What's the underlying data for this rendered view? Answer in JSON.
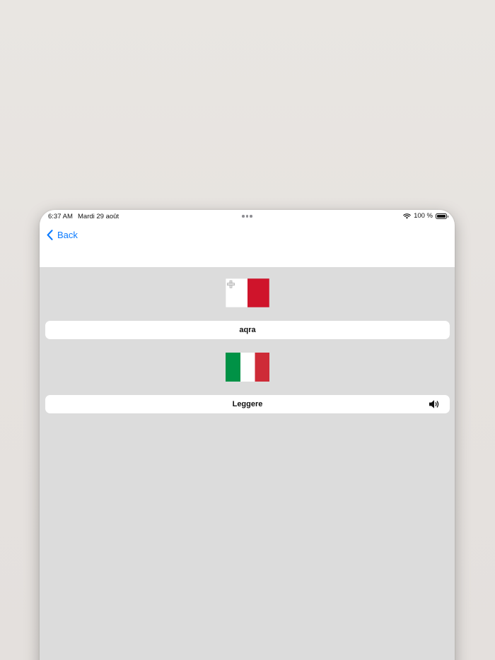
{
  "status_bar": {
    "time": "6:37 AM",
    "date": "Mardi 29 août",
    "battery": "100 %"
  },
  "nav": {
    "back_label": "Back"
  },
  "source": {
    "flag_icon": "malta-flag-icon",
    "word": "aqra"
  },
  "target": {
    "flag_icon": "italy-flag-icon",
    "word": "Leggere",
    "speaker_icon": "speaker-icon"
  },
  "colors": {
    "accent": "#0a7aff",
    "content_bg": "#dcdcdc",
    "malta_red": "#cf142b",
    "italy_green": "#009246",
    "italy_red": "#ce2b37"
  }
}
